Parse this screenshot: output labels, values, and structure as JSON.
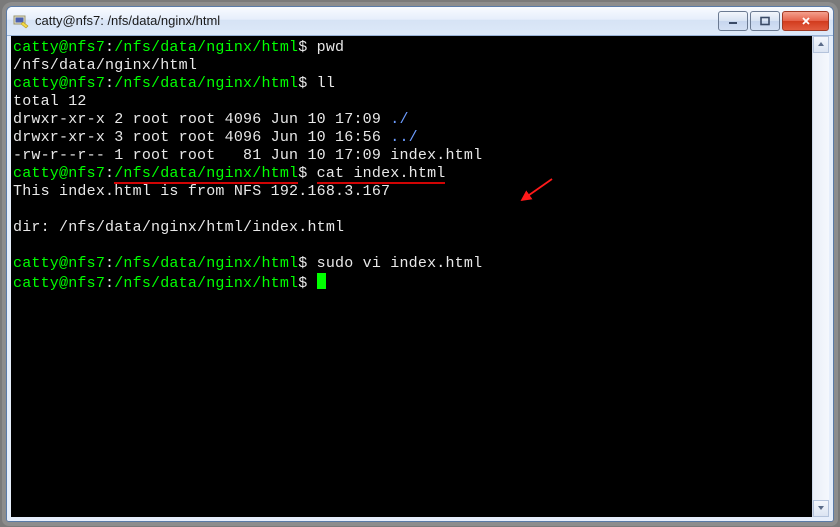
{
  "window": {
    "title": "catty@nfs7: /nfs/data/nginx/html"
  },
  "term": {
    "prompt_user": "catty@nfs7",
    "prompt_path": "/nfs/data/nginx/html",
    "prompt_marker": "$",
    "l1_cmd": "pwd",
    "l2_out": "/nfs/data/nginx/html",
    "l3_cmd": "ll",
    "l4": "total 12",
    "l5_a": "drwxr-xr-x 2 root root 4096 Jun 10 17:09 ",
    "l5_b": "./",
    "l6_a": "drwxr-xr-x 3 root root 4096 Jun 10 16:56 ",
    "l6_b": "../",
    "l7": "-rw-r--r-- 1 root root   81 Jun 10 17:09 index.html",
    "l8_cmd": "cat index.html",
    "l9": "This index.html is from NFS 192.168.3.167",
    "l10": "",
    "l11": "dir: /nfs/data/nginx/html/index.html",
    "l12": "",
    "l13_cmd": "sudo vi index.html",
    "cursor_spacer": " "
  }
}
